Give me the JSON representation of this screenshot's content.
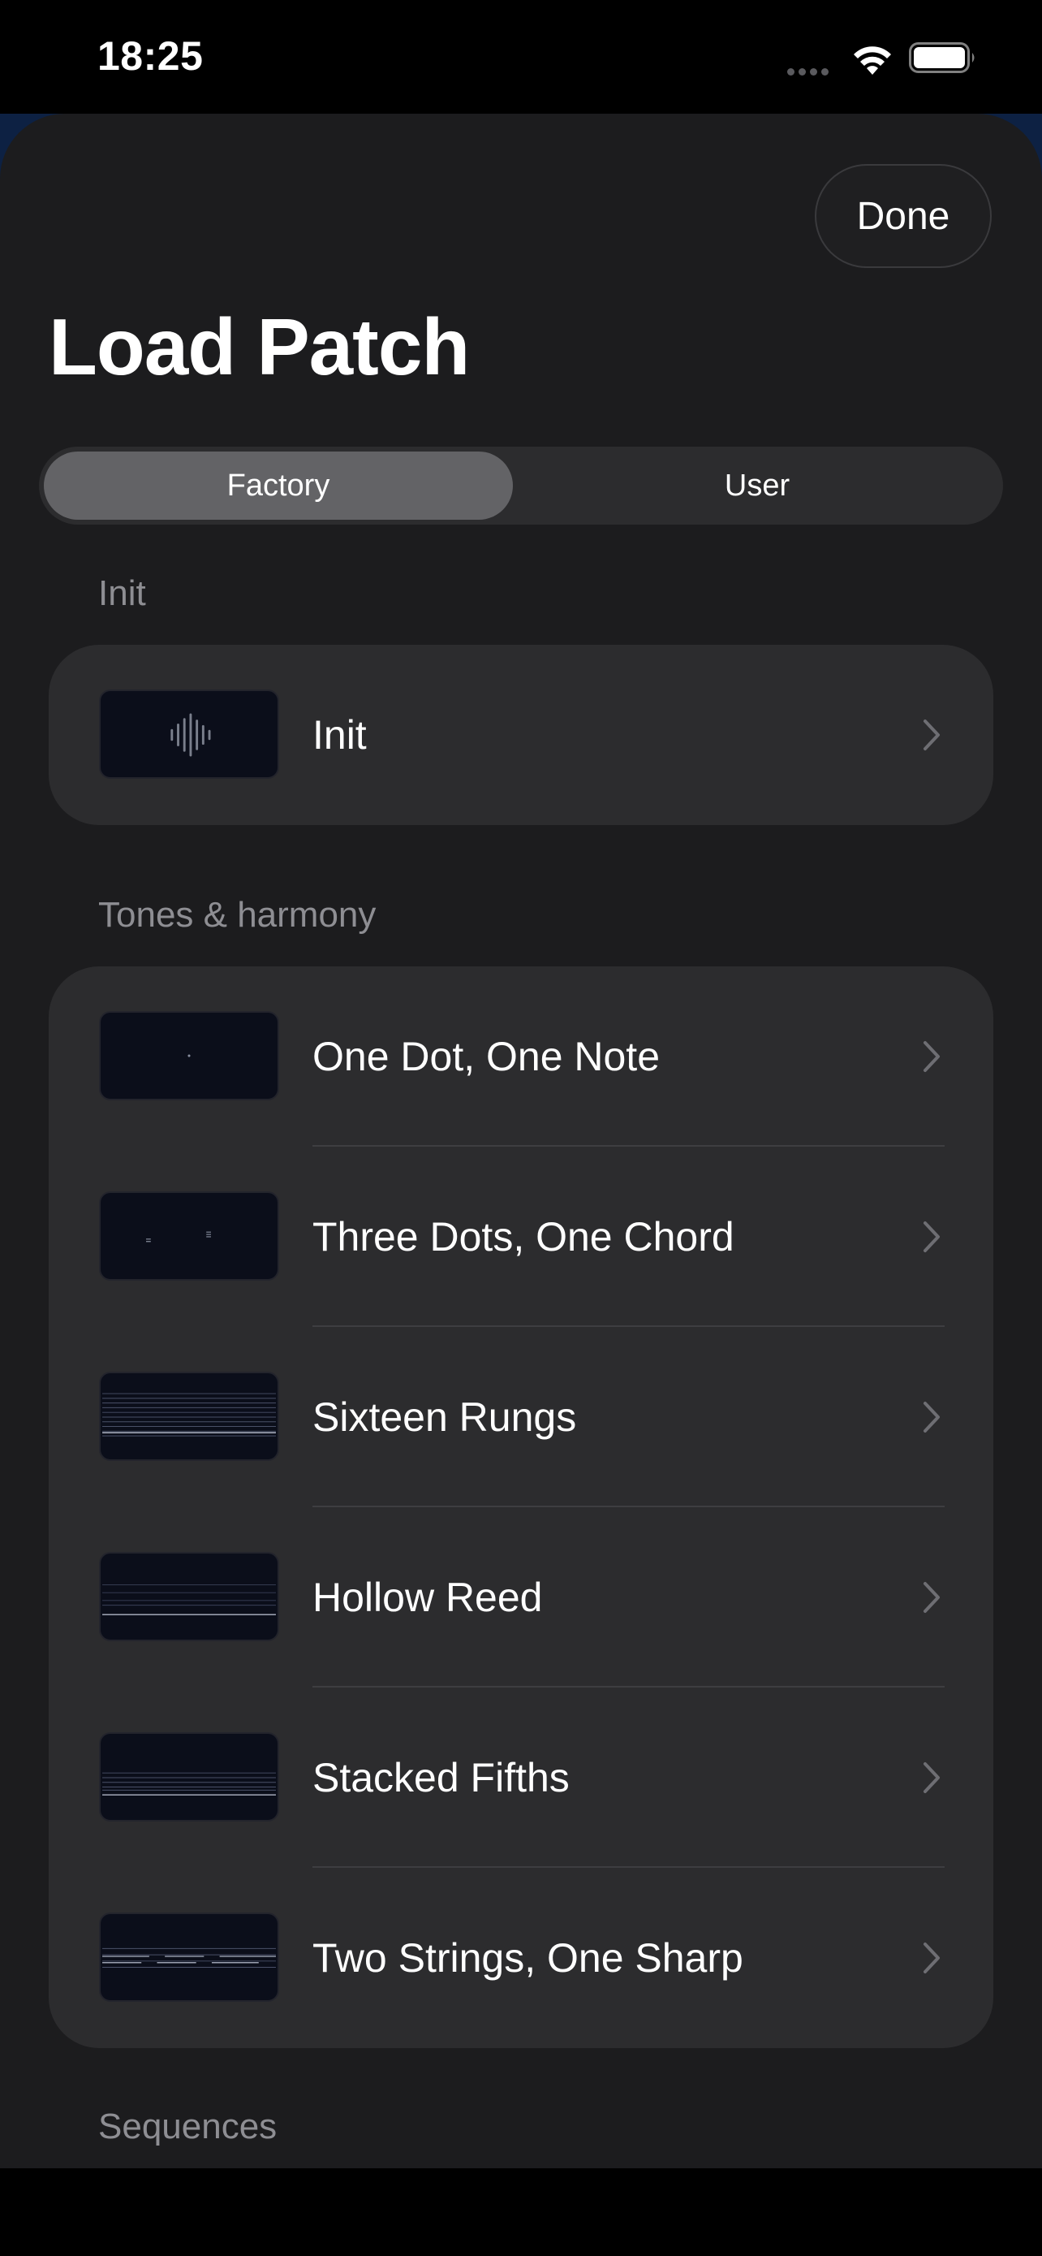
{
  "status_bar": {
    "time": "18:25"
  },
  "sheet": {
    "title": "Load Patch",
    "done_label": "Done"
  },
  "segmented": {
    "factory_label": "Factory",
    "user_label": "User",
    "selected": "Factory"
  },
  "sections": {
    "init": {
      "header": "Init",
      "items": [
        {
          "label": "Init"
        }
      ]
    },
    "tones": {
      "header": "Tones & harmony",
      "items": [
        {
          "label": "One Dot, One Note"
        },
        {
          "label": "Three Dots, One Chord"
        },
        {
          "label": "Sixteen Rungs"
        },
        {
          "label": "Hollow Reed"
        },
        {
          "label": "Stacked Fifths"
        },
        {
          "label": "Two Strings, One Sharp"
        }
      ]
    },
    "sequences": {
      "header": "Sequences"
    }
  },
  "colors": {
    "sheet_background": "#1c1c1e",
    "group_background": "#2c2c2e",
    "segment_selected": "#636366",
    "secondary_text": "#8e8e93"
  },
  "icons": [
    "wifi-icon",
    "battery-icon",
    "chevron-right-icon",
    "waveform-icon"
  ]
}
